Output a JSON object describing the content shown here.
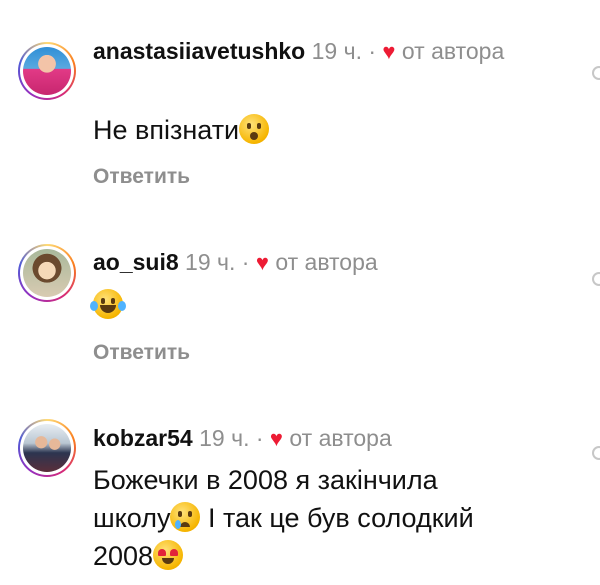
{
  "comments": [
    {
      "username": "anastasiiavetushko",
      "time": "19 ч.",
      "separator": "·",
      "heart_icon": "♥",
      "liked_by": "от автора",
      "text": "Не впізнати",
      "emoji": "hushed-face",
      "reply_label": "Ответить"
    },
    {
      "username": "ao_sui8",
      "time": "19 ч.",
      "separator": "·",
      "heart_icon": "♥",
      "liked_by": "от автора",
      "text": "",
      "emoji": "face-with-tears-of-joy",
      "reply_label": "Ответить"
    },
    {
      "username": "kobzar54",
      "time": "19 ч.",
      "separator": "·",
      "heart_icon": "♥",
      "liked_by": "от автора",
      "text_line1": "Божечки в 2008 я закінчила",
      "text_line2a": "школу",
      "text_line2b": " І так це був солодкий",
      "text_line3": "2008",
      "emoji_1": "crying-face",
      "emoji_2": "heart-eyes-face"
    }
  ],
  "colors": {
    "heart": "#ed1b34",
    "meta": "#8e8e8e",
    "text": "#111111"
  }
}
